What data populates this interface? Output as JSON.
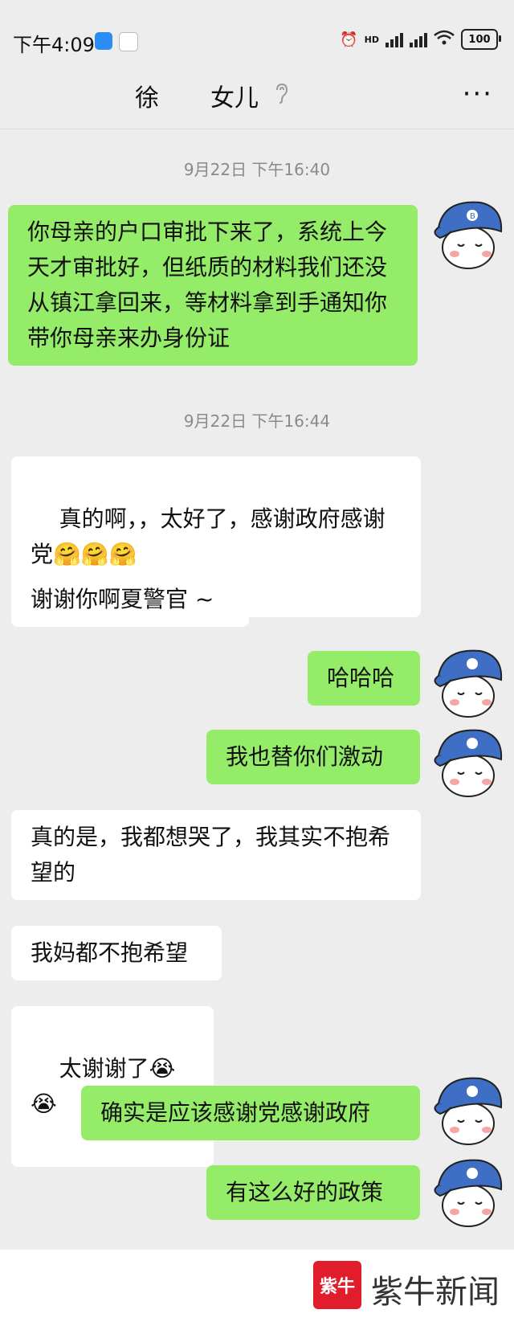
{
  "status": {
    "time": "下午4:09",
    "battery": "100",
    "hd": "HD"
  },
  "header": {
    "contact_left": "徐",
    "contact_right": "女儿"
  },
  "messages": [
    {
      "type": "time",
      "text": "9月22日 下午16:40"
    },
    {
      "type": "out",
      "text": "你母亲的户口审批下来了，系统上今天才审批好，但纸质的材料我们还没从镇江拿回来，等材料拿到手通知你带你母亲来办身份证"
    },
    {
      "type": "time",
      "text": "9月22日 下午16:44"
    },
    {
      "type": "in",
      "text": "真的啊，，太好了，感谢政府感谢党"
    },
    {
      "type": "in",
      "text": "谢谢你啊夏警官 ~"
    },
    {
      "type": "out",
      "text": "哈哈哈"
    },
    {
      "type": "out",
      "text": "我也替你们激动"
    },
    {
      "type": "in",
      "text": "真的是，我都想哭了，我其实不抱希望的"
    },
    {
      "type": "in",
      "text": "我妈都不抱希望"
    },
    {
      "type": "in",
      "text": "太谢谢了"
    },
    {
      "type": "out",
      "text": "确实是应该感谢党感谢政府"
    },
    {
      "type": "out",
      "text": "有这么好的政策"
    }
  ],
  "watermark": {
    "logo": "紫牛",
    "text": "紫牛新闻"
  },
  "colors": {
    "outgoing": "#95ec69",
    "incoming": "#ffffff",
    "background": "#ededed"
  }
}
